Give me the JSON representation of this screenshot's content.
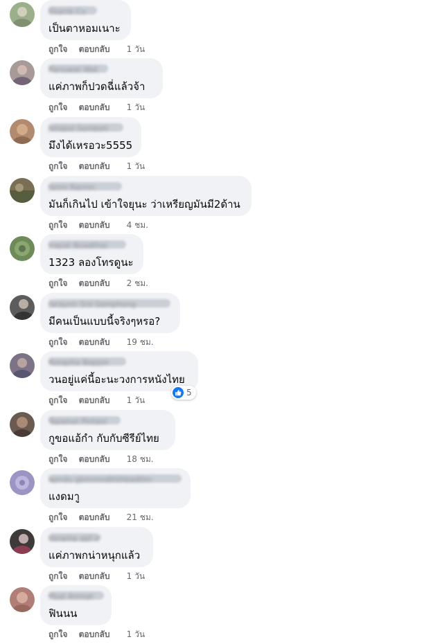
{
  "labels": {
    "like": "ถูกใจ",
    "reply": "ตอบกลับ"
  },
  "comments": [
    {
      "author": "Ekanik Cv",
      "text": "เป็นตาหอมเนาะ",
      "time": "1 วัน",
      "avatar_color": "#9bb08a"
    },
    {
      "author": "Panuwat Wat",
      "text": "แค่ภาพก็ปวดฉี่แล้วจ้า",
      "time": "1 วัน",
      "avatar_color": "#a89a98"
    },
    {
      "author": "Jetapol Somboh",
      "text": "มึงได้เหรอวะ5555",
      "time": "1 วัน",
      "avatar_color": "#b28a70"
    },
    {
      "author": "Janm Rarmn",
      "text": "มันก็เกินไป เข้าใจยุนะ ว่าเหรียญมันมี2ด้าน",
      "time": "4 ชม.",
      "avatar_color": "#7a6e54"
    },
    {
      "author": "Jrapat Boadthai",
      "text": "1323 ลองโทรดูนะ",
      "time": "2 ชม.",
      "avatar_color": "#6d8a58"
    },
    {
      "author": "Jaraynn Srd Samphong",
      "text": "มีคนเป็นแบบนี้จริงๆหรอ?",
      "time": "19 ชม.",
      "avatar_color": "#5c5c5c"
    },
    {
      "author": "Rotapha Bapjon",
      "text": "วนอยู่แค่นี้อะนะวงการหนังไทย",
      "time": "1 วัน",
      "avatar_color": "#7c7486",
      "reactions": "5"
    },
    {
      "author": "Tapanut Pintavi",
      "text": "กูขอแอ้กำ กับกับซีรีย์ไทย",
      "time": "18 ชม.",
      "avatar_color": "#6a5a50"
    },
    {
      "author": "apndu gbmmndththbadthn",
      "text": "แงดมาู",
      "time": "21 ชม.",
      "avatar_color": "#9c94c2"
    },
    {
      "author": "sbrama apf sf",
      "text": "แค่ภาพกน่าหนุกแล้ว",
      "time": "1 วัน",
      "avatar_color": "#3e3a3a"
    },
    {
      "author": "Pbat Amnat",
      "text": "ฟินนน",
      "time": "1 วัน",
      "avatar_color": "#b07e76"
    }
  ]
}
